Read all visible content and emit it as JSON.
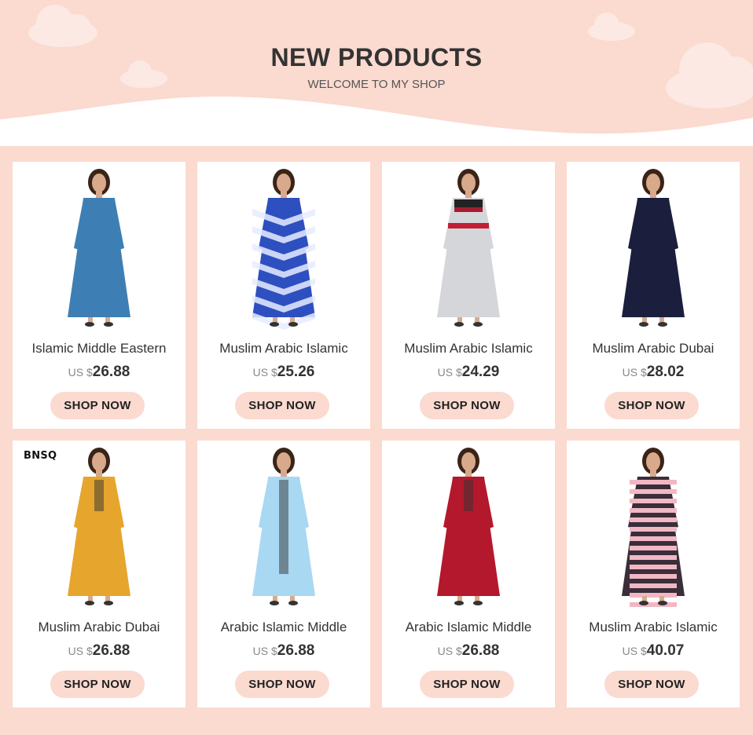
{
  "header": {
    "title": "NEW PRODUCTS",
    "subtitle": "WELCOME TO MY SHOP"
  },
  "colors": {
    "background": "#fbdad0",
    "card": "#ffffff",
    "button": "#fbdad0",
    "text": "#333333"
  },
  "products": [
    {
      "name": "Islamic Middle Eastern",
      "currency": "US $",
      "price": "26.88",
      "button": "SHOP NOW",
      "dress_color": "#3d7fb5"
    },
    {
      "name": "Muslim Arabic Islamic",
      "currency": "US $",
      "price": "25.26",
      "button": "SHOP NOW",
      "dress_color": "#2e4fc0"
    },
    {
      "name": "Muslim Arabic Islamic",
      "currency": "US $",
      "price": "24.29",
      "button": "SHOP NOW",
      "dress_color": "#d4d6da"
    },
    {
      "name": "Muslim Arabic Dubai",
      "currency": "US $",
      "price": "28.02",
      "button": "SHOP NOW",
      "dress_color": "#1b1f3d"
    },
    {
      "name": "Muslim Arabic Dubai",
      "currency": "US $",
      "price": "26.88",
      "button": "SHOP NOW",
      "dress_color": "#e6a52c",
      "badge": "BNSQ"
    },
    {
      "name": "Arabic Islamic Middle",
      "currency": "US $",
      "price": "26.88",
      "button": "SHOP NOW",
      "dress_color": "#a9d8f2"
    },
    {
      "name": "Arabic Islamic Middle",
      "currency": "US $",
      "price": "26.88",
      "button": "SHOP NOW",
      "dress_color": "#b3182c"
    },
    {
      "name": "Muslim Arabic Islamic",
      "currency": "US $",
      "price": "40.07",
      "button": "SHOP NOW",
      "dress_color": "#3a2e3a"
    }
  ]
}
